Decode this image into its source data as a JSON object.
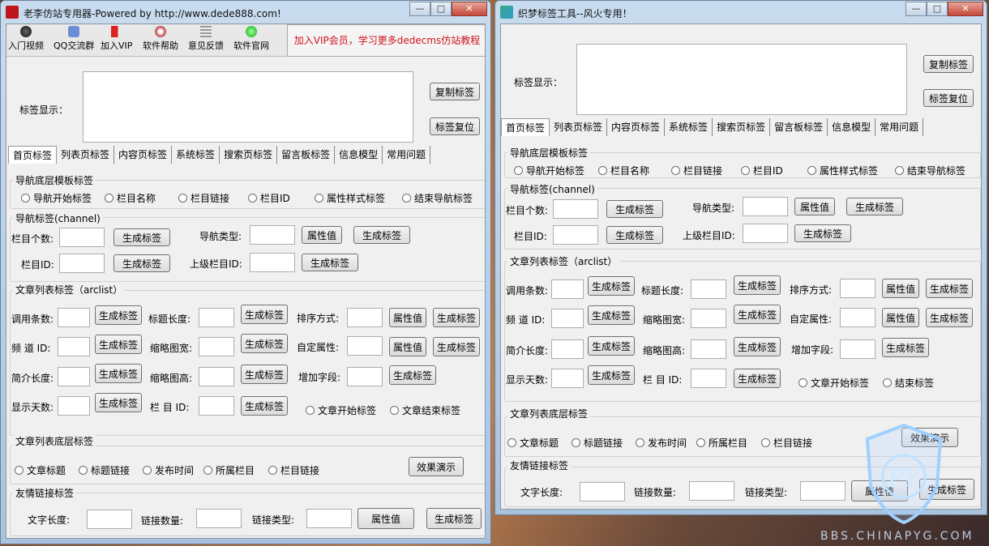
{
  "left_window": {
    "title": "老李仿站专用器-Powered by http://www.dede888.com!",
    "toolbar": [
      {
        "label": "入门视频",
        "icon": "video-icon"
      },
      {
        "label": "QQ交流群",
        "icon": "qq-group-icon"
      },
      {
        "label": "加入VIP",
        "icon": "vip-flag-icon"
      },
      {
        "label": "软件帮助",
        "icon": "help-icon"
      },
      {
        "label": "意见反馈",
        "icon": "feedback-icon"
      },
      {
        "label": "软件官网",
        "icon": "website-icon"
      }
    ],
    "vip_banner": "加入VIP会员，学习更多dedecms仿站教程"
  },
  "right_window": {
    "title": "织梦标签工具--风火专用！"
  },
  "common": {
    "tag_display": "标签显示：",
    "copy_tag": "复制标签",
    "reset_tag": "标签复位",
    "tabs": [
      "首页标签",
      "列表页标签",
      "内容页标签",
      "系统标签",
      "搜索页标签",
      "留言板标签",
      "信息模型",
      "常用问题"
    ],
    "nav_bottom_group": "导航底层模板标签",
    "nav_bottom_radios": [
      "导航开始标签",
      "栏目名称",
      "栏目链接",
      "栏目ID",
      "属性样式标签",
      "结束导航标签"
    ],
    "nav_group": "导航标签(channel)",
    "col_count": "栏目个数:",
    "gen_tag": "生成标签",
    "nav_type": "导航类型:",
    "attr_val": "属性值",
    "col_id": "栏目ID:",
    "parent_col_id": "上级栏目ID:",
    "arclist_group": "文章列表标签（arclist）",
    "call_count": "调用条数:",
    "title_len": "标题长度:",
    "sort_way": "排序方式:",
    "channel_id": "频 道 ID:",
    "thumb_w": "缩略图宽:",
    "custom_attr": "自定属性:",
    "intro_len": "简介长度:",
    "thumb_h": "缩略图高:",
    "add_field": "增加字段:",
    "show_days": "显示天数:",
    "col_id2": "栏 目 ID:",
    "art_start": "文章开始标签",
    "art_end": "结束标签",
    "art_end_left": "文章结束标签",
    "art_bottom_group": "文章列表底层标签",
    "art_bottom_radios": [
      "文章标题",
      "标题链接",
      "发布时间",
      "所属栏目",
      "栏目链接"
    ],
    "demo": "效果演示",
    "friend_group": "友情链接标签",
    "text_len": "文字长度:",
    "link_count": "链接数量:",
    "link_type": "链接类型:"
  },
  "watermark": {
    "text": "BBS.CHINAPYG.COM",
    "logo": "PY"
  }
}
